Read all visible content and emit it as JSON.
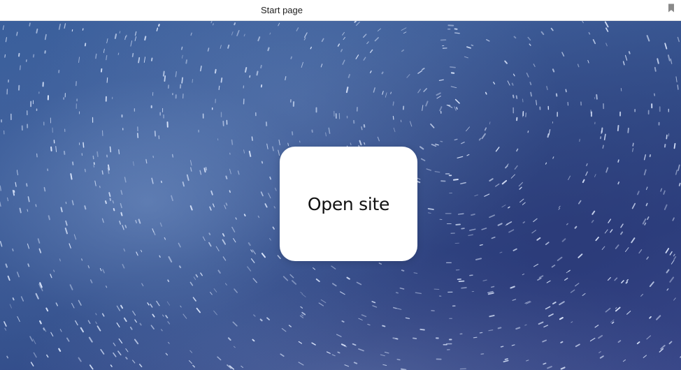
{
  "window": {
    "title": "Start page"
  },
  "icons": {
    "bookmark": "bookmark-icon"
  },
  "main": {
    "open_site_label": "Open site"
  },
  "colors": {
    "card_background": "#ffffff",
    "sky_primary": "#3a5f9c",
    "sky_dark": "#2f4485"
  }
}
